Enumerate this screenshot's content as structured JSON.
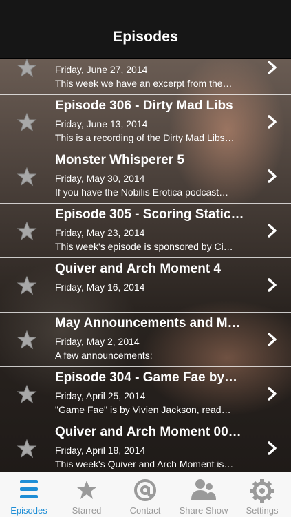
{
  "header": {
    "title": "Episodes"
  },
  "episodes": [
    {
      "title": "",
      "date": "Friday, June 27, 2014",
      "desc": "This week we have an excerpt from the…"
    },
    {
      "title": "Episode 306 - Dirty Mad Libs",
      "date": "Friday, June 13, 2014",
      "desc": "This is a recording of the Dirty Mad Libs…"
    },
    {
      "title": "Monster Whisperer 5",
      "date": "Friday, May 30, 2014",
      "desc": "If you have the Nobilis Erotica podcast…"
    },
    {
      "title": "Episode 305 - Scoring Static…",
      "date": "Friday, May 23, 2014",
      "desc": "This week's episode is sponsored by Ci…"
    },
    {
      "title": "Quiver and Arch Moment 4",
      "date": "Friday, May 16, 2014",
      "desc": ""
    },
    {
      "title": "May Announcements and M…",
      "date": "Friday, May 2, 2014",
      "desc": "A few announcements:"
    },
    {
      "title": "Episode 304 - Game Fae by…",
      "date": "Friday, April 25, 2014",
      "desc": "\"Game Fae\" is by Vivien Jackson, read…"
    },
    {
      "title": "Quiver and Arch Moment 00…",
      "date": "Friday, April 18, 2014",
      "desc": "This week's Quiver and Arch Moment is…"
    }
  ],
  "tabs": [
    {
      "label": "Episodes",
      "icon": "list-icon",
      "active": true
    },
    {
      "label": "Starred",
      "icon": "star-icon",
      "active": false
    },
    {
      "label": "Contact",
      "icon": "at-sign-icon",
      "active": false
    },
    {
      "label": "Share Show",
      "icon": "people-icon",
      "active": false
    },
    {
      "label": "Settings",
      "icon": "gear-icon",
      "active": false
    }
  ],
  "colors": {
    "accent": "#1e8ed6",
    "tab_inactive": "#999999",
    "navbar": "#161616"
  }
}
